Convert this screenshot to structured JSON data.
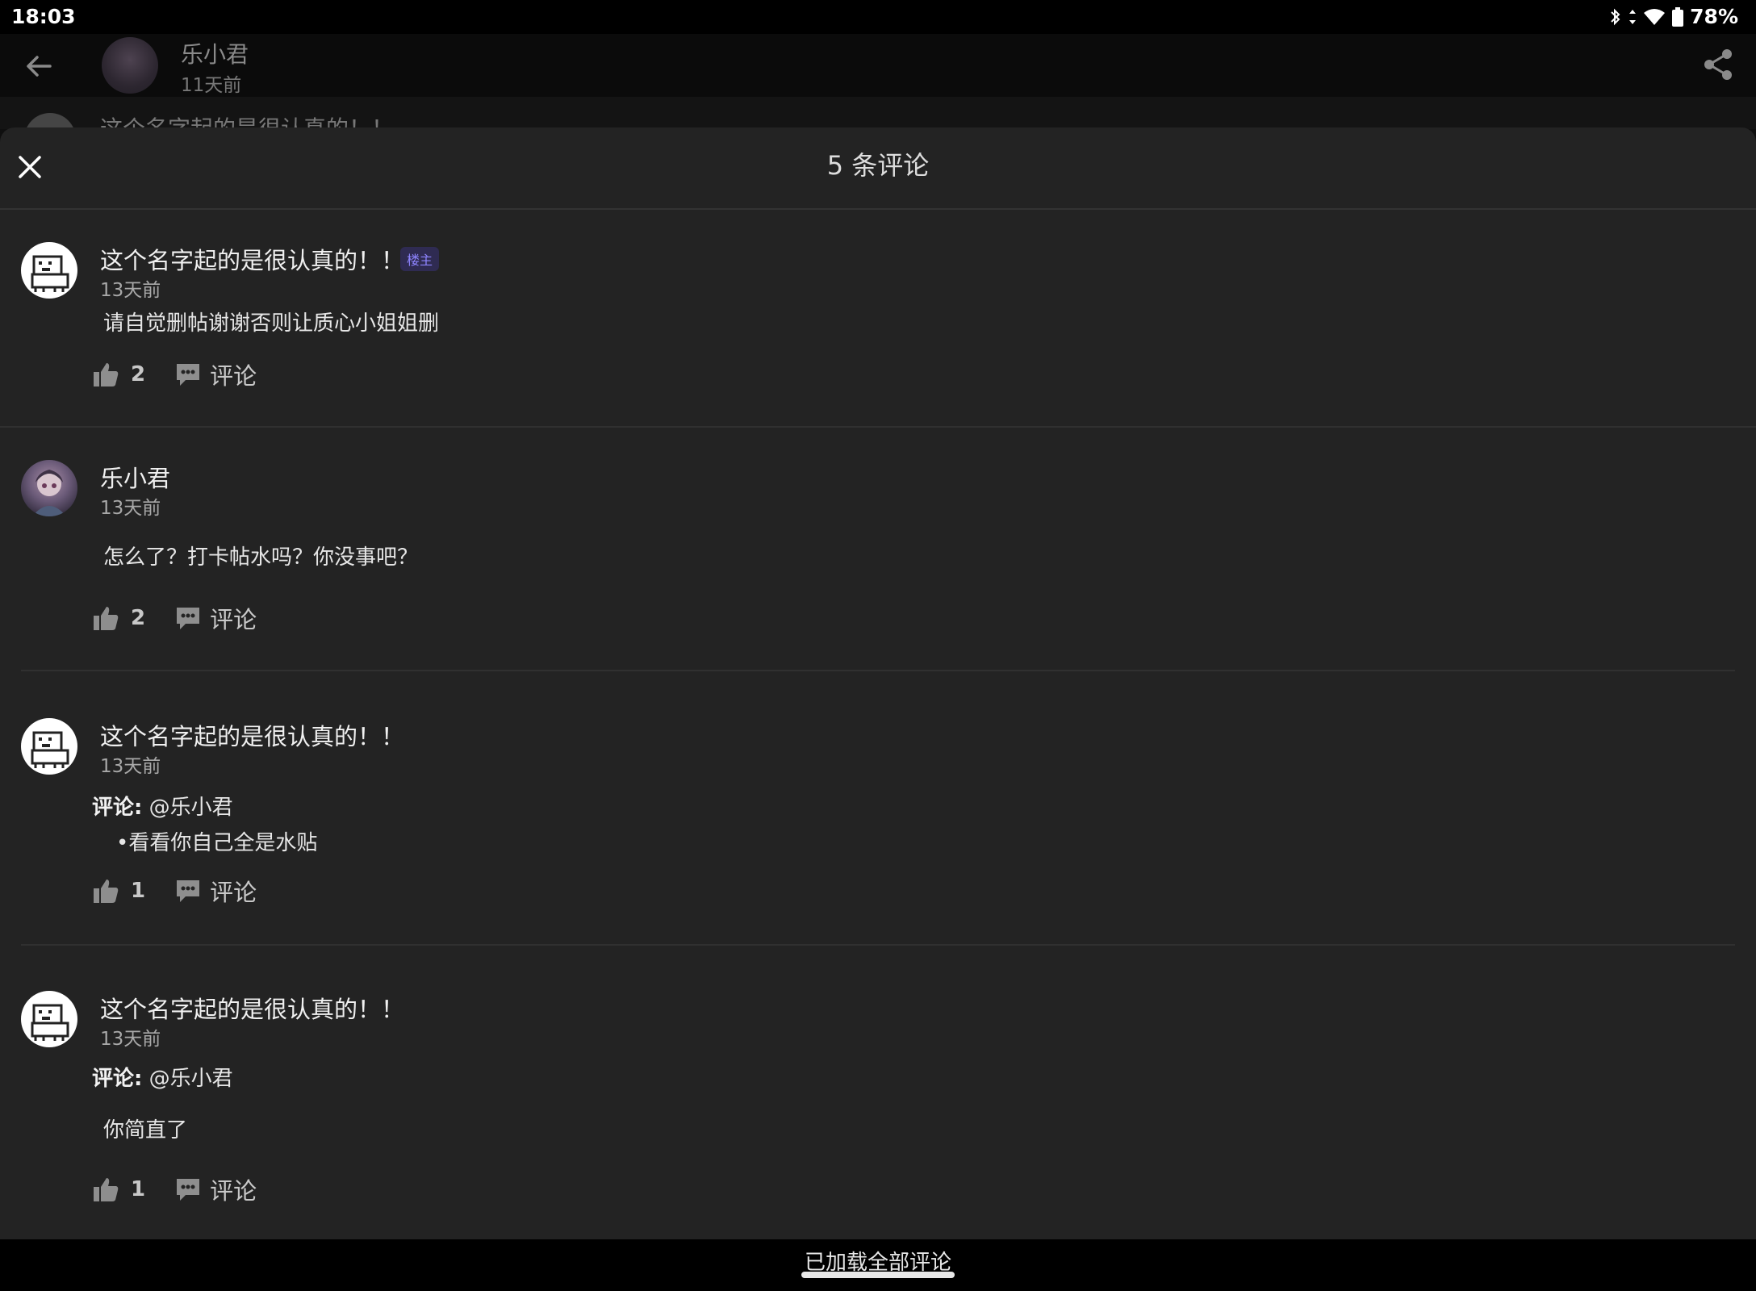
{
  "status_bar": {
    "time": "18:03",
    "battery": "78%"
  },
  "post_header": {
    "author_name": "乐小君",
    "author_time": "11天前",
    "peek_text": "这个名字起的是很认真的！！"
  },
  "sheet": {
    "title": "5 条评论",
    "reply_label": "评论"
  },
  "comments": [
    {
      "name": "这个名字起的是很认真的！！",
      "badge": "楼主",
      "time": "13天前",
      "body": "请自觉删帖谢谢否则让质心小姐姐删",
      "likes": "2",
      "avatar": "dog-icon"
    },
    {
      "name": "乐小君",
      "time": "13天前",
      "body": "怎么了？打卡帖水吗？你没事吧？",
      "likes": "2",
      "avatar": "girl-icon"
    },
    {
      "name": "这个名字起的是很认真的！！",
      "time": "13天前",
      "reply_prefix": "评论:",
      "reply_to": "@乐小君",
      "body": "•看看你自己全是水贴",
      "likes": "1",
      "avatar": "dog-icon"
    },
    {
      "name": "这个名字起的是很认真的！！",
      "time": "13天前",
      "reply_prefix": "评论:",
      "reply_to": "@乐小君",
      "body": "你简直了",
      "likes": "1",
      "avatar": "dog-icon"
    }
  ],
  "footer": {
    "loaded_text": "已加载全部评论"
  }
}
